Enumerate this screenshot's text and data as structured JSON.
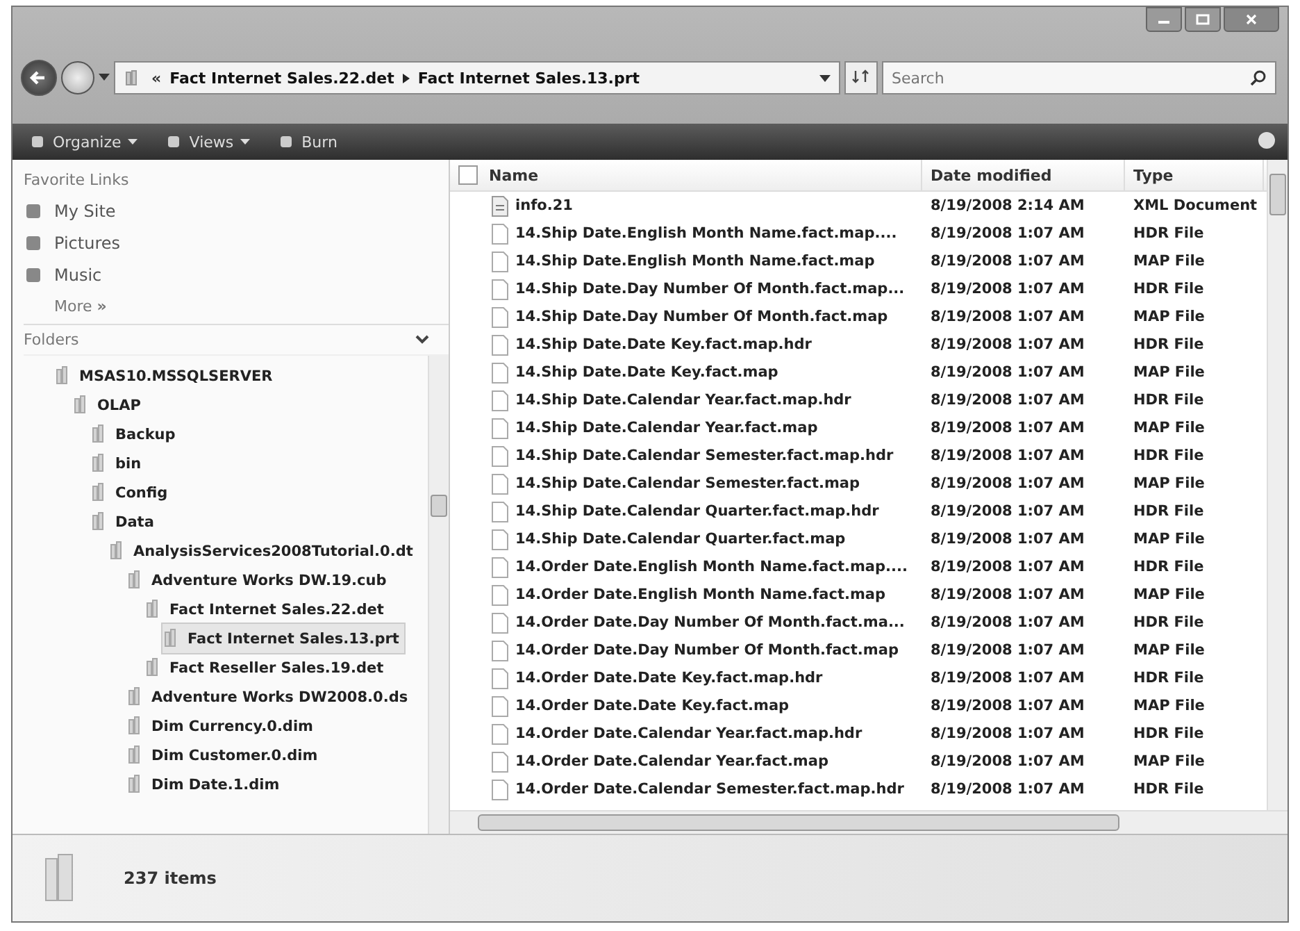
{
  "address_bar": {
    "overflow": "«",
    "crumbs": [
      "Fact Internet Sales.22.det",
      "Fact Internet Sales.13.prt"
    ]
  },
  "search": {
    "placeholder": "Search"
  },
  "toolbar": {
    "buttons": [
      "Organize",
      "Views",
      "Burn"
    ]
  },
  "favorite_links": {
    "title": "Favorite Links",
    "items": [
      "My Site",
      "Pictures",
      "Music"
    ],
    "more": "More",
    "more_glyph": "»"
  },
  "folders": {
    "title": "Folders",
    "tree": [
      {
        "label": "MSAS10.MSSQLSERVER",
        "selected": false,
        "children": [
          {
            "label": "OLAP",
            "selected": false,
            "children": [
              {
                "label": "Backup",
                "selected": false
              },
              {
                "label": "bin",
                "selected": false
              },
              {
                "label": "Config",
                "selected": false
              },
              {
                "label": "Data",
                "selected": false,
                "children": [
                  {
                    "label": "AnalysisServices2008Tutorial.0.dt",
                    "selected": false,
                    "children": [
                      {
                        "label": "Adventure Works DW.19.cub",
                        "selected": false,
                        "children": [
                          {
                            "label": "Fact Internet Sales.22.det",
                            "selected": false,
                            "children": [
                              {
                                "label": "Fact Internet Sales.13.prt",
                                "selected": true
                              }
                            ]
                          },
                          {
                            "label": "Fact Reseller Sales.19.det",
                            "selected": false
                          }
                        ]
                      },
                      {
                        "label": "Adventure Works DW2008.0.ds",
                        "selected": false
                      },
                      {
                        "label": "Dim Currency.0.dim",
                        "selected": false
                      },
                      {
                        "label": "Dim Customer.0.dim",
                        "selected": false
                      },
                      {
                        "label": "Dim Date.1.dim",
                        "selected": false
                      }
                    ]
                  }
                ]
              }
            ]
          }
        ]
      }
    ]
  },
  "file_list": {
    "columns": [
      "Name",
      "Date modified",
      "Type"
    ],
    "rows": [
      {
        "kind": "xml",
        "name": "info.21",
        "date": "8/19/2008 2:14 AM",
        "type": "XML Document"
      },
      {
        "kind": "file",
        "name": "14.Ship Date.English Month Name.fact.map....",
        "date": "8/19/2008 1:07 AM",
        "type": "HDR File"
      },
      {
        "kind": "file",
        "name": "14.Ship Date.English Month Name.fact.map",
        "date": "8/19/2008 1:07 AM",
        "type": "MAP File"
      },
      {
        "kind": "file",
        "name": "14.Ship Date.Day Number Of Month.fact.map...",
        "date": "8/19/2008 1:07 AM",
        "type": "HDR File"
      },
      {
        "kind": "file",
        "name": "14.Ship Date.Day Number Of Month.fact.map",
        "date": "8/19/2008 1:07 AM",
        "type": "MAP File"
      },
      {
        "kind": "file",
        "name": "14.Ship Date.Date Key.fact.map.hdr",
        "date": "8/19/2008 1:07 AM",
        "type": "HDR File"
      },
      {
        "kind": "file",
        "name": "14.Ship Date.Date Key.fact.map",
        "date": "8/19/2008 1:07 AM",
        "type": "MAP File"
      },
      {
        "kind": "file",
        "name": "14.Ship Date.Calendar Year.fact.map.hdr",
        "date": "8/19/2008 1:07 AM",
        "type": "HDR File"
      },
      {
        "kind": "file",
        "name": "14.Ship Date.Calendar Year.fact.map",
        "date": "8/19/2008 1:07 AM",
        "type": "MAP File"
      },
      {
        "kind": "file",
        "name": "14.Ship Date.Calendar Semester.fact.map.hdr",
        "date": "8/19/2008 1:07 AM",
        "type": "HDR File"
      },
      {
        "kind": "file",
        "name": "14.Ship Date.Calendar Semester.fact.map",
        "date": "8/19/2008 1:07 AM",
        "type": "MAP File"
      },
      {
        "kind": "file",
        "name": "14.Ship Date.Calendar Quarter.fact.map.hdr",
        "date": "8/19/2008 1:07 AM",
        "type": "HDR File"
      },
      {
        "kind": "file",
        "name": "14.Ship Date.Calendar Quarter.fact.map",
        "date": "8/19/2008 1:07 AM",
        "type": "MAP File"
      },
      {
        "kind": "file",
        "name": "14.Order Date.English Month Name.fact.map....",
        "date": "8/19/2008 1:07 AM",
        "type": "HDR File"
      },
      {
        "kind": "file",
        "name": "14.Order Date.English Month Name.fact.map",
        "date": "8/19/2008 1:07 AM",
        "type": "MAP File"
      },
      {
        "kind": "file",
        "name": "14.Order Date.Day Number Of Month.fact.ma...",
        "date": "8/19/2008 1:07 AM",
        "type": "HDR File"
      },
      {
        "kind": "file",
        "name": "14.Order Date.Day Number Of Month.fact.map",
        "date": "8/19/2008 1:07 AM",
        "type": "MAP File"
      },
      {
        "kind": "file",
        "name": "14.Order Date.Date Key.fact.map.hdr",
        "date": "8/19/2008 1:07 AM",
        "type": "HDR File"
      },
      {
        "kind": "file",
        "name": "14.Order Date.Date Key.fact.map",
        "date": "8/19/2008 1:07 AM",
        "type": "MAP File"
      },
      {
        "kind": "file",
        "name": "14.Order Date.Calendar Year.fact.map.hdr",
        "date": "8/19/2008 1:07 AM",
        "type": "HDR File"
      },
      {
        "kind": "file",
        "name": "14.Order Date.Calendar Year.fact.map",
        "date": "8/19/2008 1:07 AM",
        "type": "MAP File"
      },
      {
        "kind": "file",
        "name": "14.Order Date.Calendar Semester.fact.map.hdr",
        "date": "8/19/2008 1:07 AM",
        "type": "HDR File"
      }
    ]
  },
  "status_bar": {
    "count": "237 items"
  }
}
